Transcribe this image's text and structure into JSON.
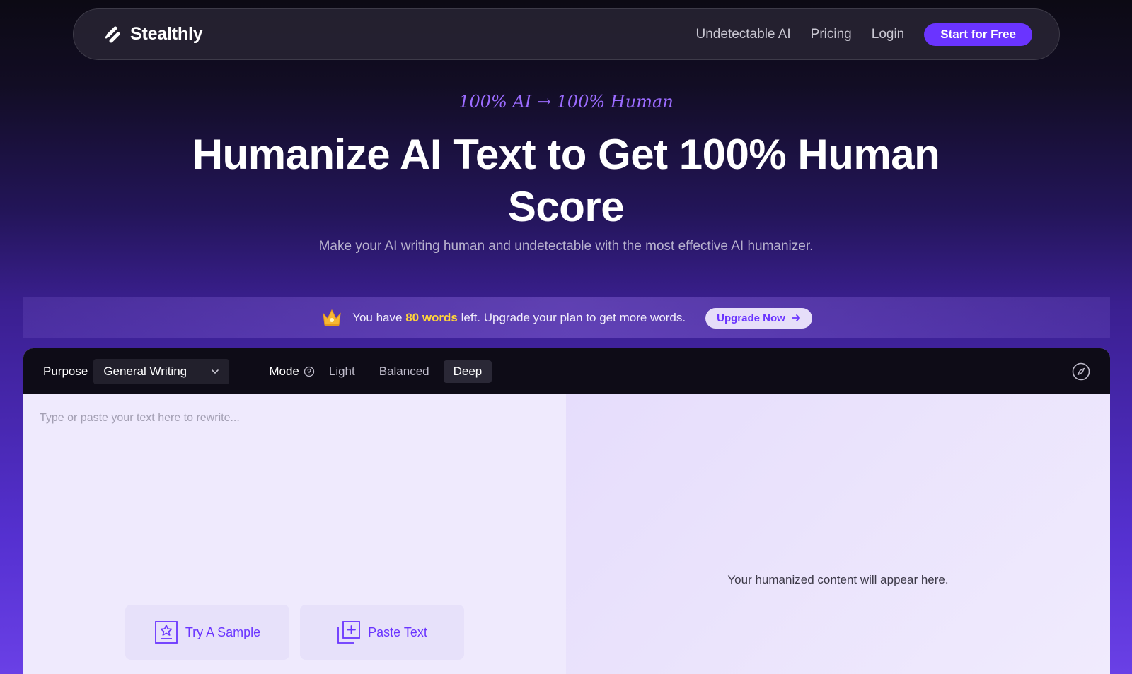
{
  "nav": {
    "brand": "Stealthly",
    "links": [
      "Undetectable AI",
      "Pricing",
      "Login"
    ],
    "cta": "Start for Free"
  },
  "hero": {
    "eyebrow": "100% AI → 100% Human",
    "headline": "Humanize AI Text to Get 100% Human Score",
    "subhead": "Make your AI writing human and undetectable with the most effective AI humanizer."
  },
  "banner": {
    "text_before": "You have ",
    "highlight": "80 words",
    "text_after": " left. Upgrade your plan to get more words.",
    "button": "Upgrade Now"
  },
  "editor": {
    "purpose_label": "Purpose",
    "purpose_value": "General Writing",
    "mode_label": "Mode",
    "modes": [
      "Light",
      "Balanced",
      "Deep"
    ],
    "active_mode": "Deep",
    "input_placeholder": "Type or paste your text here to rewrite...",
    "sample_button": "Try A Sample",
    "paste_button": "Paste Text",
    "output_placeholder": "Your humanized content will appear here."
  },
  "icons": {
    "logo": "stealthly-logo-icon",
    "crown": "crown-icon",
    "arrow": "arrow-right-icon",
    "chevron": "chevron-down-icon",
    "help": "help-circle-icon",
    "compass": "compass-icon",
    "sample": "star-document-icon",
    "paste": "paste-plus-icon"
  },
  "colors": {
    "accent": "#6a34ff",
    "eyebrow": "#9b6bff",
    "highlight": "#ffd43b"
  }
}
